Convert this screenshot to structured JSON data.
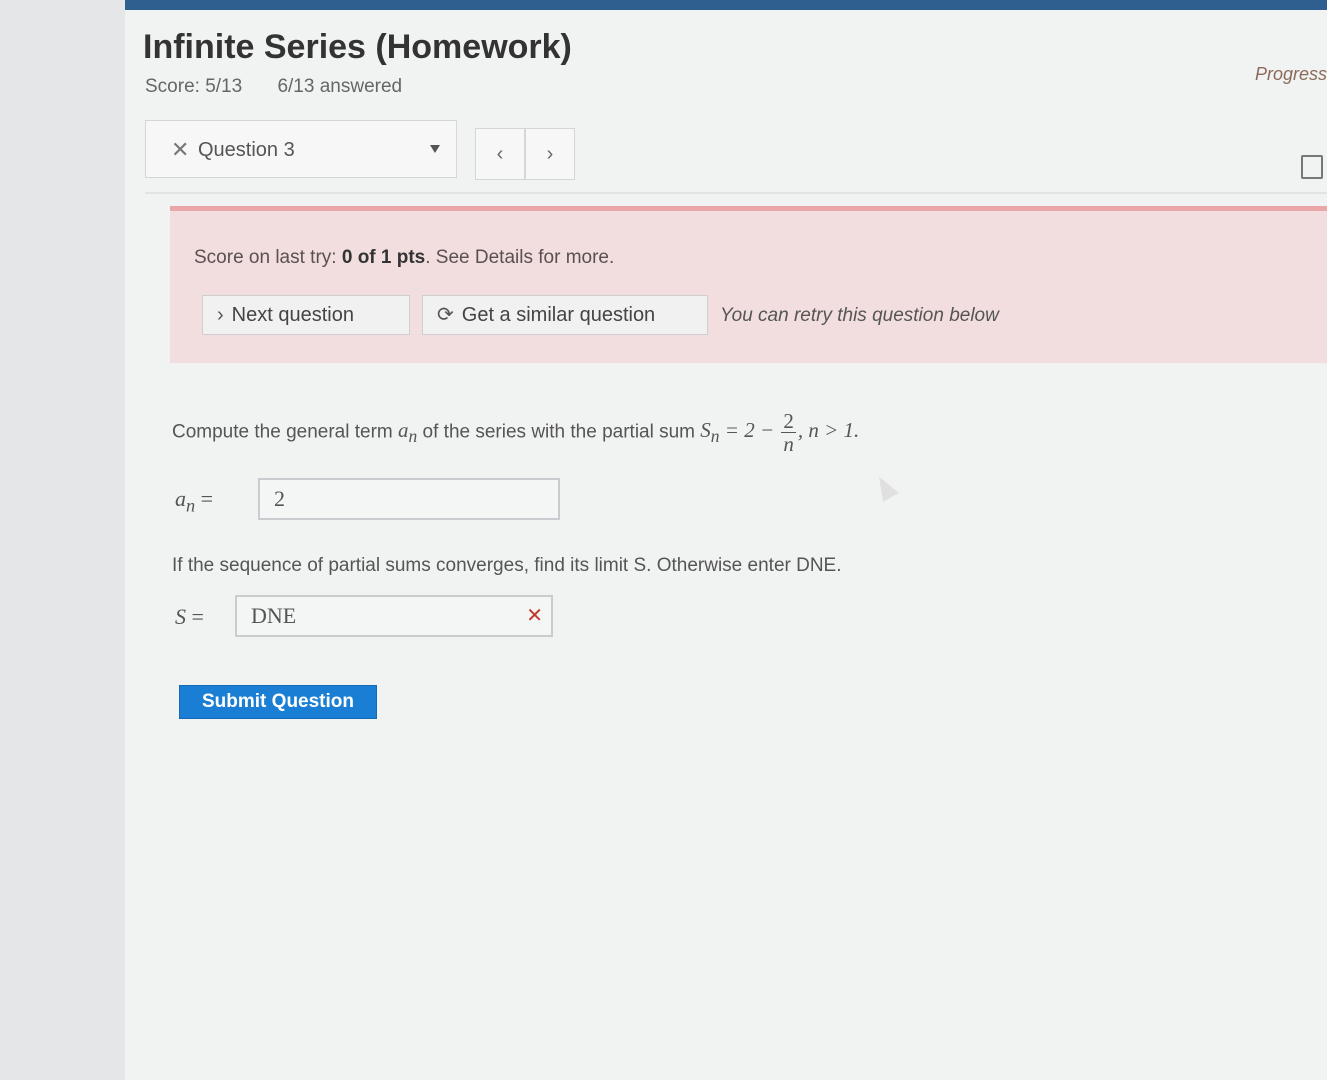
{
  "header": {
    "title": "Infinite Series (Homework)",
    "score": "Score: 5/13",
    "answered": "6/13 answered",
    "progress_link": "Progress"
  },
  "nav": {
    "question_label": "Question 3",
    "status_mark": "✕",
    "prev_label": "‹",
    "next_label": "›"
  },
  "alert": {
    "prefix": "Score on last try: ",
    "score_bold": "0 of 1 pts",
    "suffix": ". See Details for more.",
    "next_question_label": "Next question",
    "similar_question_label": "Get a similar question",
    "retry_note": "You can retry this question below"
  },
  "problem": {
    "text_before": "Compute the general term ",
    "term_symbol": "a",
    "term_sub": "n",
    "text_middle": " of the series with the partial sum ",
    "sum_symbol": "S",
    "sum_sub": "n",
    "eq_prefix": " = 2 − ",
    "frac_num": "2",
    "frac_den": "n",
    "eq_suffix": ", n > 1."
  },
  "answer_an": {
    "label_var": "a",
    "label_sub": "n",
    "label_eq": " =",
    "value": "2"
  },
  "question2": {
    "text": "If the sequence of partial sums converges, find its limit S. Otherwise enter DNE."
  },
  "answer_s": {
    "label_var": "S",
    "label_eq": " =",
    "value": "DNE",
    "status_mark": "✕"
  },
  "submit_label": "Submit Question",
  "colors": {
    "top_bar": "#2f5f8e",
    "alert_bg": "#f2dede",
    "submit_bg": "#1a7fd4",
    "error": "#c0392b"
  }
}
